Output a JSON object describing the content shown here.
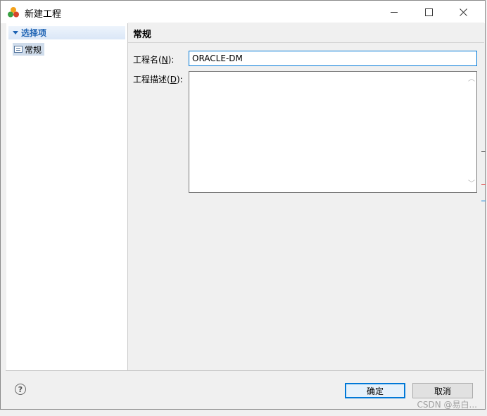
{
  "window": {
    "title": "新建工程",
    "minimize_glyph": "—",
    "maximize_glyph": "☐",
    "close_glyph": "✕"
  },
  "tree": {
    "header": "选择项",
    "items": [
      {
        "label": "常规"
      }
    ]
  },
  "section": {
    "title": "常规"
  },
  "form": {
    "name_label_prefix": "工程名(",
    "name_label_key": "N",
    "name_label_suffix": "):",
    "name_value": "ORACLE-DM",
    "desc_label_prefix": "工程描述(",
    "desc_label_key": "D",
    "desc_label_suffix": "):",
    "desc_value": ""
  },
  "buttons": {
    "ok": "确定",
    "cancel": "取消",
    "help": "?"
  },
  "watermark": "CSDN @易白...",
  "colors": {
    "accent": "#0078d7",
    "tree_header_text": "#1f64b4",
    "selected_item": "#cfdceb"
  }
}
